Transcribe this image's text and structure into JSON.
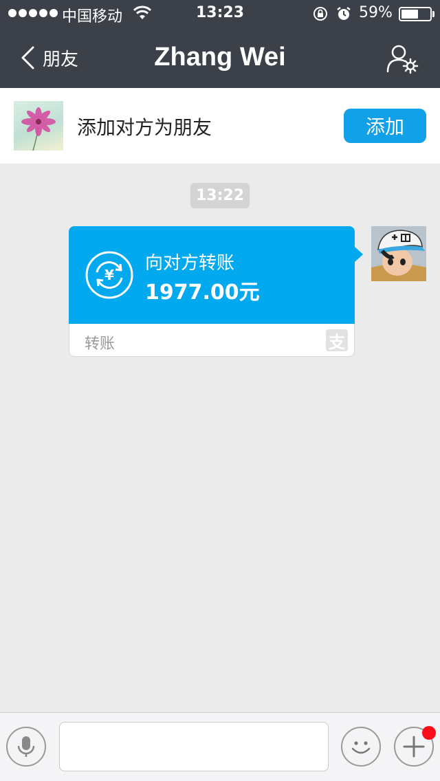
{
  "status_bar": {
    "carrier": "中国移动",
    "time": "13:23",
    "battery_percent": "59%",
    "battery_level": 0.59,
    "signal_bars": 5
  },
  "nav": {
    "back_label": "朋友",
    "title": "Zhang Wei",
    "profile_icon": "user-settings-icon"
  },
  "banner": {
    "text": "添加对方为朋友",
    "add_button": "添加"
  },
  "chat": {
    "timestamp": "13:22",
    "transfer": {
      "title": "向对方转账",
      "amount": "1977.00元",
      "footer": "转账",
      "currency_symbol": "¥",
      "brand_mark": "支"
    }
  },
  "input_bar": {
    "placeholder": "",
    "unread_badge": true
  },
  "colors": {
    "header_bg": "#3c4048",
    "accent_blue": "#12a0e8",
    "transfer_blue": "#02a9ee",
    "chat_bg": "#ebebeb",
    "badge_red": "#fc0d1b"
  }
}
